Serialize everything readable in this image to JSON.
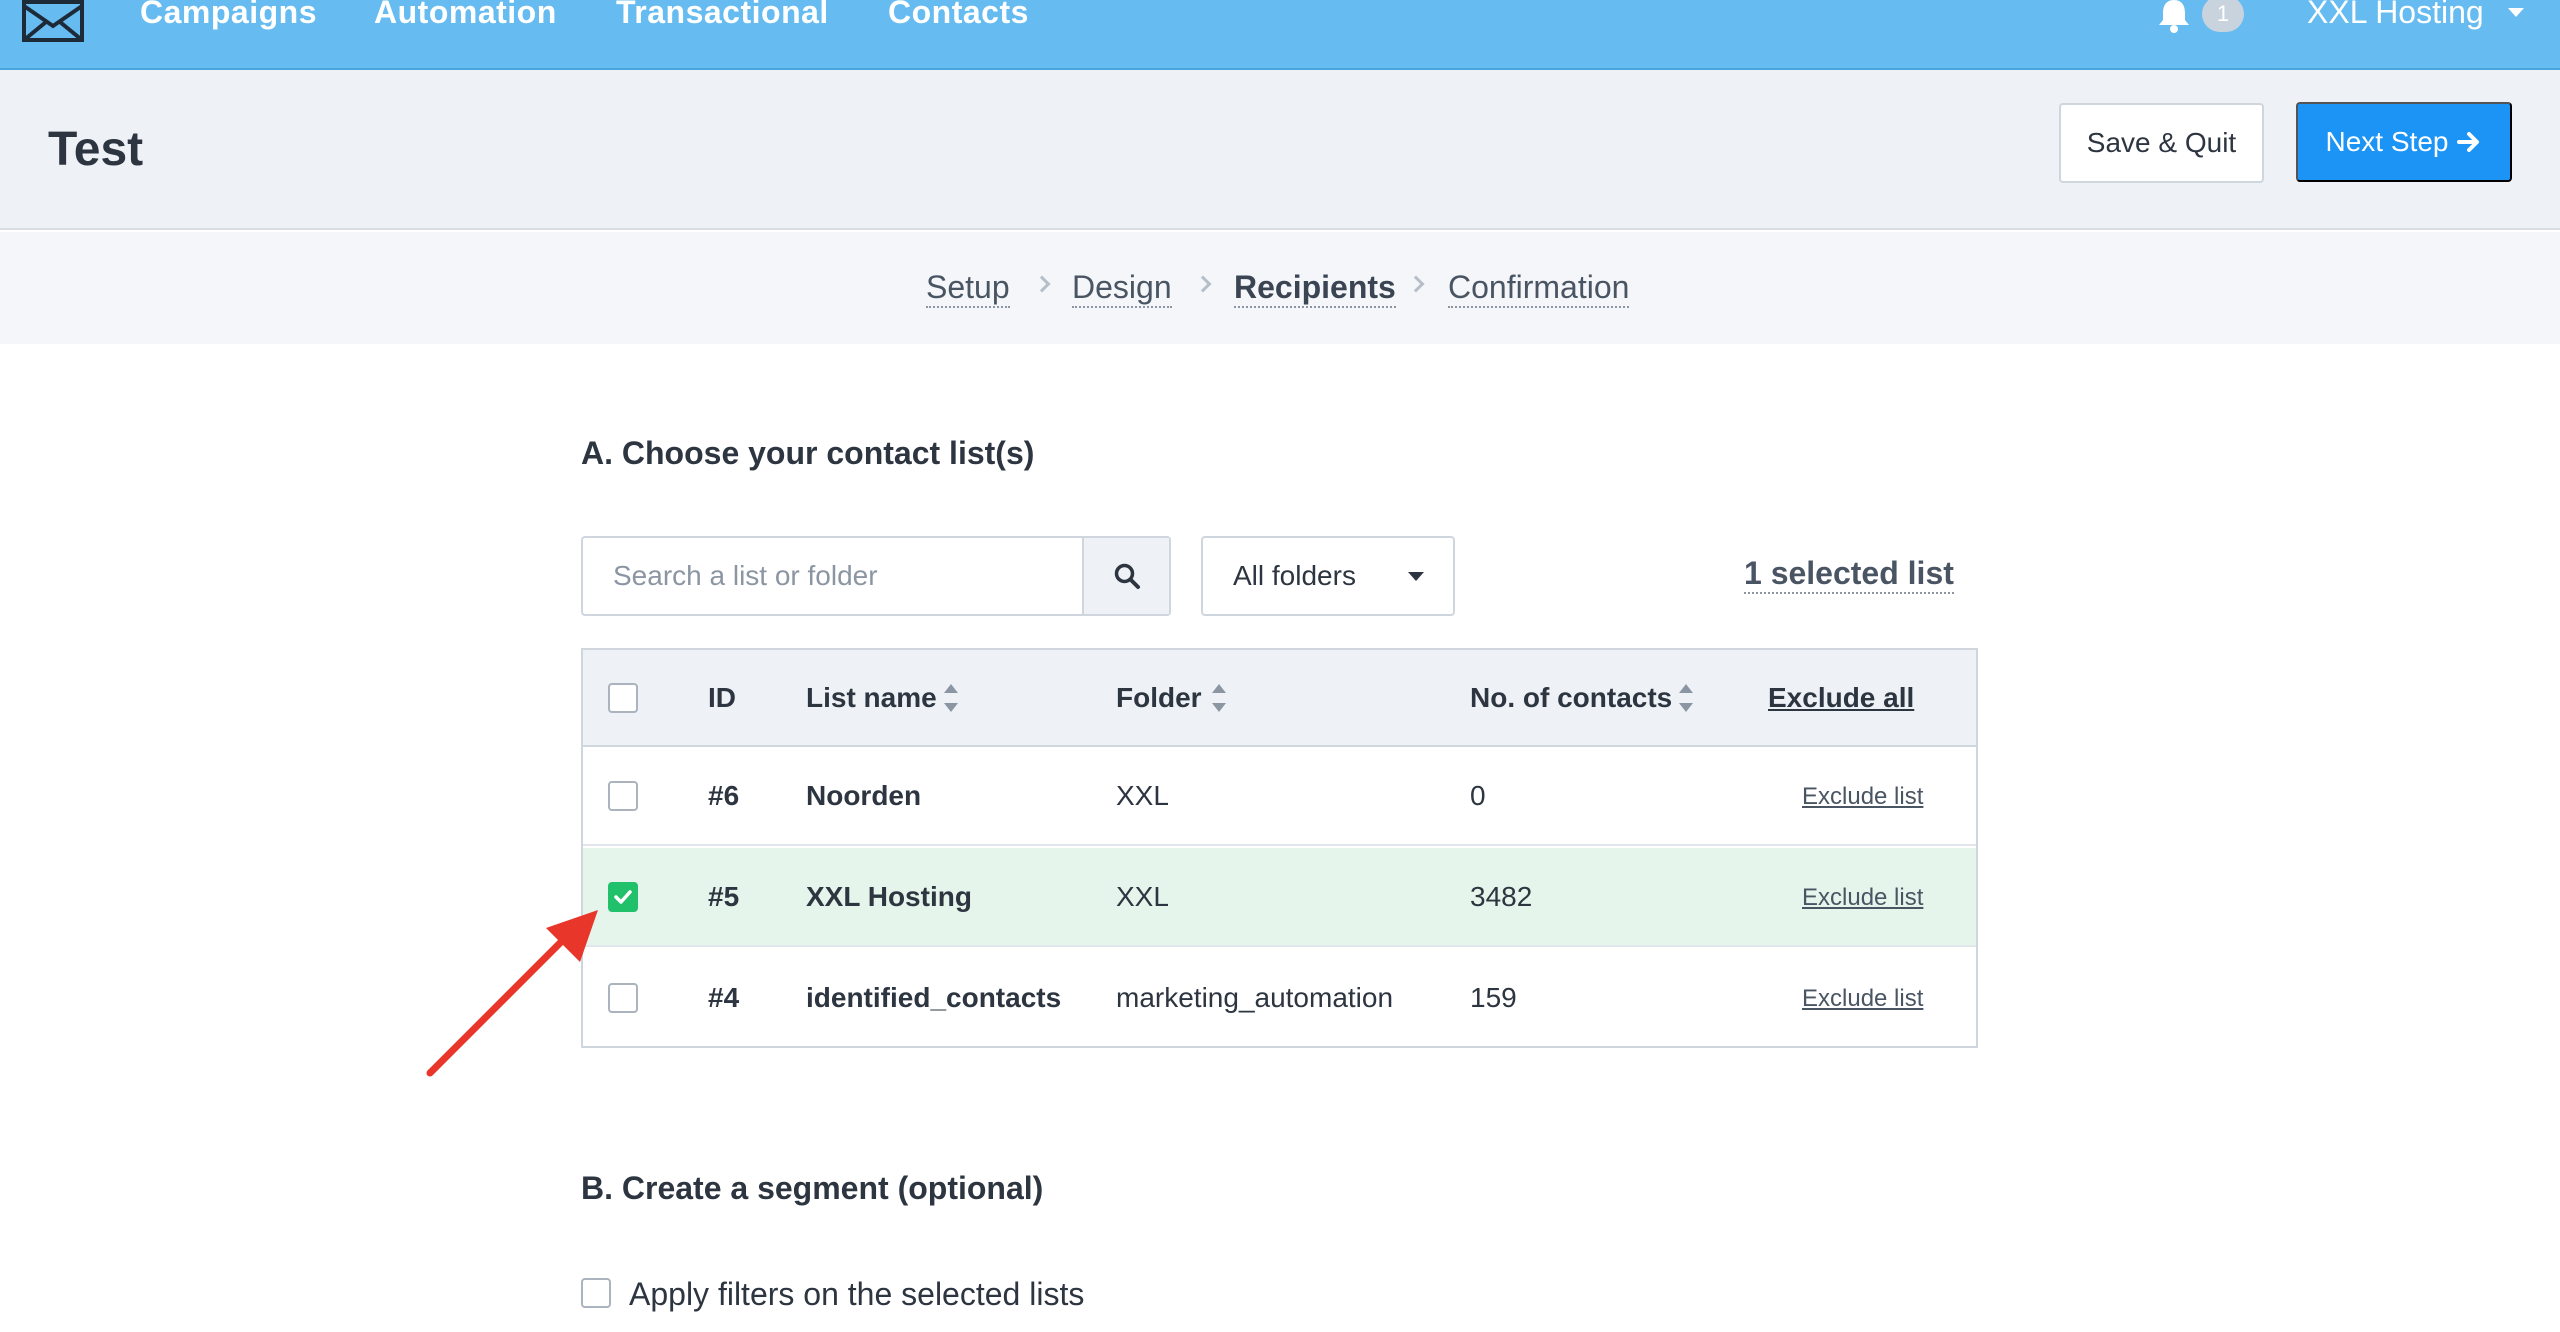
{
  "nav": {
    "items": [
      "Campaigns",
      "Automation",
      "Transactional",
      "Contacts"
    ],
    "notifications_count": "1",
    "account_name": "XXL Hosting"
  },
  "header": {
    "title": "Test",
    "save_label": "Save & Quit",
    "next_label": "Next Step"
  },
  "steps": [
    "Setup",
    "Design",
    "Recipients",
    "Confirmation"
  ],
  "section_a": {
    "title": "A. Choose your contact list(s)",
    "search_placeholder": "Search a list or folder",
    "folder_select": "All folders",
    "selected_count": "1 selected list"
  },
  "table": {
    "headers": {
      "id": "ID",
      "list_name": "List name",
      "folder": "Folder",
      "contacts": "No. of contacts",
      "exclude_all": "Exclude all"
    },
    "rows": [
      {
        "id": "#6",
        "name": "Noorden",
        "folder": "XXL",
        "contacts": "0",
        "action": "Exclude list",
        "checked": false
      },
      {
        "id": "#5",
        "name": "XXL Hosting",
        "folder": "XXL",
        "contacts": "3482",
        "action": "Exclude list",
        "checked": true
      },
      {
        "id": "#4",
        "name": "identified_contacts",
        "folder": "marketing_automation",
        "contacts": "159",
        "action": "Exclude list",
        "checked": false
      }
    ]
  },
  "section_b": {
    "title": "B. Create a segment (optional)",
    "apply_filters_label": "Apply filters on the selected lists"
  },
  "colors": {
    "nav_bg": "#66bbf0",
    "primary": "#1b94f5",
    "checked": "#21c06a",
    "selected_row": "#e6f5ec",
    "annotation_arrow": "#e8362a"
  }
}
